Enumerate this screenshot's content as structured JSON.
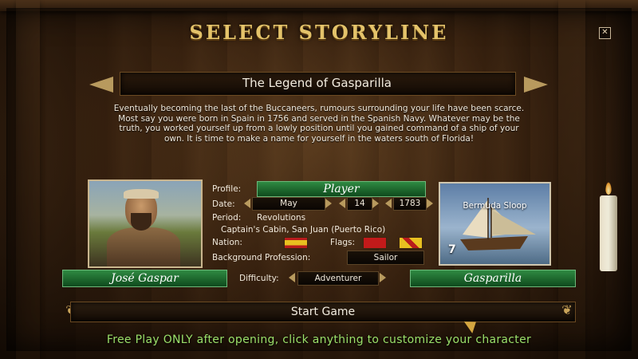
{
  "header": {
    "title": "SELECT STORYLINE",
    "close_glyph": "✕"
  },
  "storyline": {
    "title": "The Legend of Gasparilla",
    "description": "Eventually becoming the last of the Buccaneers, rumours surrounding your life have been scarce. Most say you were born in Spain in 1756 and served in the Spanish Navy. Whatever may be the truth, you worked yourself up from a lowly position until you gained command of a ship of your own. It is time to make a name for yourself in the waters south of Florida!"
  },
  "character": {
    "profile_label": "Profile:",
    "profile_value": "Player",
    "date_label": "Date:",
    "date_month": "May",
    "date_day": "14",
    "date_year": "1783",
    "period_label": "Period:",
    "period_value": "Revolutions",
    "location": "Captain's Cabin, San Juan (Puerto Rico)",
    "nation_label": "Nation:",
    "flags_label": "Flags:",
    "profession_label": "Background Profession:",
    "profession_value": "Sailor",
    "difficulty_label": "Difficulty:",
    "difficulty_value": "Adventurer",
    "name": "José Gaspar",
    "nickname": "Gasparilla"
  },
  "ship": {
    "name": "Bermuda Sloop",
    "level": "7"
  },
  "actions": {
    "start_label": "Start Game"
  },
  "footer": {
    "hint": "Free Play ONLY after opening, click anything to customize your character"
  },
  "colors": {
    "title_gold": "#e4c36a",
    "green_button": "#2f8a42",
    "footer_green": "#9be06a"
  }
}
